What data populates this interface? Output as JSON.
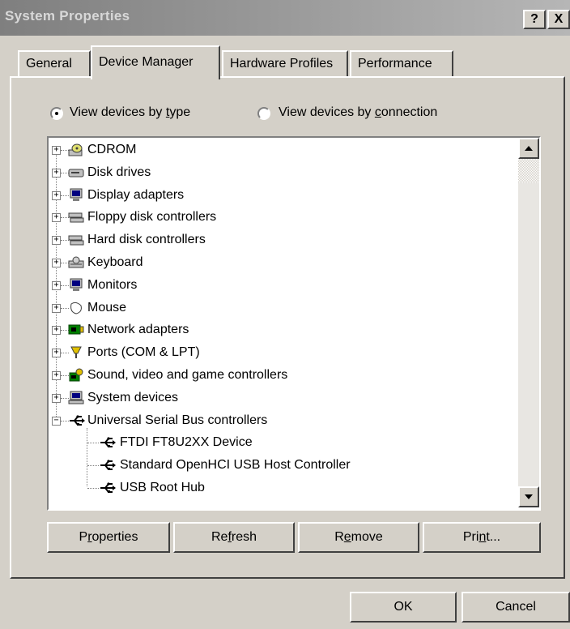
{
  "window": {
    "title": "System Properties",
    "help_label": "?",
    "close_label": "X"
  },
  "tabs": [
    {
      "label": "General"
    },
    {
      "label": "Device Manager",
      "active": true
    },
    {
      "label": "Hardware Profiles"
    },
    {
      "label": "Performance"
    }
  ],
  "view_options": {
    "by_type": {
      "prefix": "View devices by ",
      "accel": "t",
      "suffix": "ype",
      "selected": true
    },
    "by_connection": {
      "prefix": "View devices by ",
      "accel": "c",
      "suffix": "onnection",
      "selected": false
    }
  },
  "devices": [
    {
      "label": "CDROM",
      "icon": "cdrom-icon"
    },
    {
      "label": "Disk drives",
      "icon": "disk-drive-icon"
    },
    {
      "label": "Display adapters",
      "icon": "monitor-icon"
    },
    {
      "label": "Floppy disk controllers",
      "icon": "controller-icon"
    },
    {
      "label": "Hard disk controllers",
      "icon": "controller-icon"
    },
    {
      "label": "Keyboard",
      "icon": "keyboard-icon"
    },
    {
      "label": "Monitors",
      "icon": "monitor-icon"
    },
    {
      "label": "Mouse",
      "icon": "mouse-icon"
    },
    {
      "label": "Network adapters",
      "icon": "network-card-icon"
    },
    {
      "label": "Ports (COM & LPT)",
      "icon": "port-icon"
    },
    {
      "label": "Sound, video and game controllers",
      "icon": "sound-icon"
    },
    {
      "label": "System devices",
      "icon": "computer-icon"
    },
    {
      "label": "Universal Serial Bus controllers",
      "icon": "usb-icon",
      "expanded": true
    }
  ],
  "usb_children": [
    {
      "label": "FTDI FT8U2XX Device",
      "icon": "usb-icon"
    },
    {
      "label": "Standard OpenHCI USB Host Controller",
      "icon": "usb-icon"
    },
    {
      "label": "USB Root Hub",
      "icon": "usb-icon"
    }
  ],
  "buttons": {
    "properties": {
      "prefix": "P",
      "accel": "r",
      "suffix": "operties"
    },
    "refresh": {
      "prefix": "Re",
      "accel": "f",
      "suffix": "resh"
    },
    "remove": {
      "prefix": "R",
      "accel": "e",
      "suffix": "move"
    },
    "print": {
      "prefix": "Pri",
      "accel": "n",
      "suffix": "t..."
    },
    "ok": "OK",
    "cancel": "Cancel"
  },
  "colors": {
    "face": "#d4d0c8",
    "usb": "#000000"
  }
}
